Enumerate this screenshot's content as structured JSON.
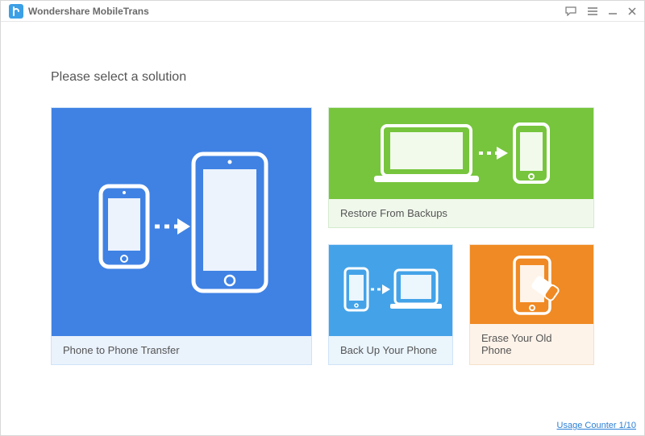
{
  "titlebar": {
    "appName": "Wondershare MobileTrans"
  },
  "heading": "Please select a solution",
  "cards": {
    "phoneToPhone": {
      "label": "Phone to Phone Transfer"
    },
    "restore": {
      "label": "Restore From Backups"
    },
    "backup": {
      "label": "Back Up Your Phone"
    },
    "erase": {
      "label": "Erase Your Old Phone"
    }
  },
  "footer": {
    "usageCounter": "Usage Counter 1/10"
  },
  "colors": {
    "blue": "#3f82e4",
    "green": "#77c53d",
    "lightBlue": "#44a3e8",
    "orange": "#f08a24"
  }
}
